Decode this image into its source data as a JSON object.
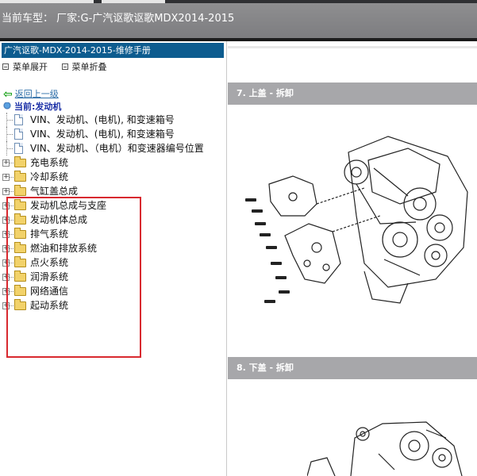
{
  "header": {
    "vehicle_label": "当前车型：  厂家:G-广汽讴歌讴歌MDX2014-2015"
  },
  "sidebar": {
    "manual_title": "广汽讴歌-MDX-2014-2015-维修手册",
    "expand_label": "菜单展开",
    "collapse_label": "菜单折叠",
    "back_link": "返回上一级",
    "current_label": "当前:发动机",
    "documents": [
      "VIN、发动机、(电机), 和变速箱号",
      "VIN、发动机、(电机), 和变速箱号",
      "VIN、发动机、（电机）和变速器编号位置"
    ],
    "folders": [
      "充电系统",
      "冷却系统",
      "气缸盖总成",
      "发动机总成与支座",
      "发动机体总成",
      "排气系统",
      "燃油和排放系统",
      "点火系统",
      "润滑系统",
      "网络通信",
      "起动系统"
    ]
  },
  "content": {
    "sections": [
      {
        "title": "7. 上盖 - 拆卸"
      },
      {
        "title": "8. 下盖 - 拆卸"
      }
    ]
  },
  "colors": {
    "header_bg": "#838386",
    "manual_title_bg": "#0d5c8f",
    "highlight_border": "#d8292f",
    "section_title_bg": "#a7a7aa",
    "current_text": "#1a2fa6",
    "link": "#2f6fa9"
  }
}
